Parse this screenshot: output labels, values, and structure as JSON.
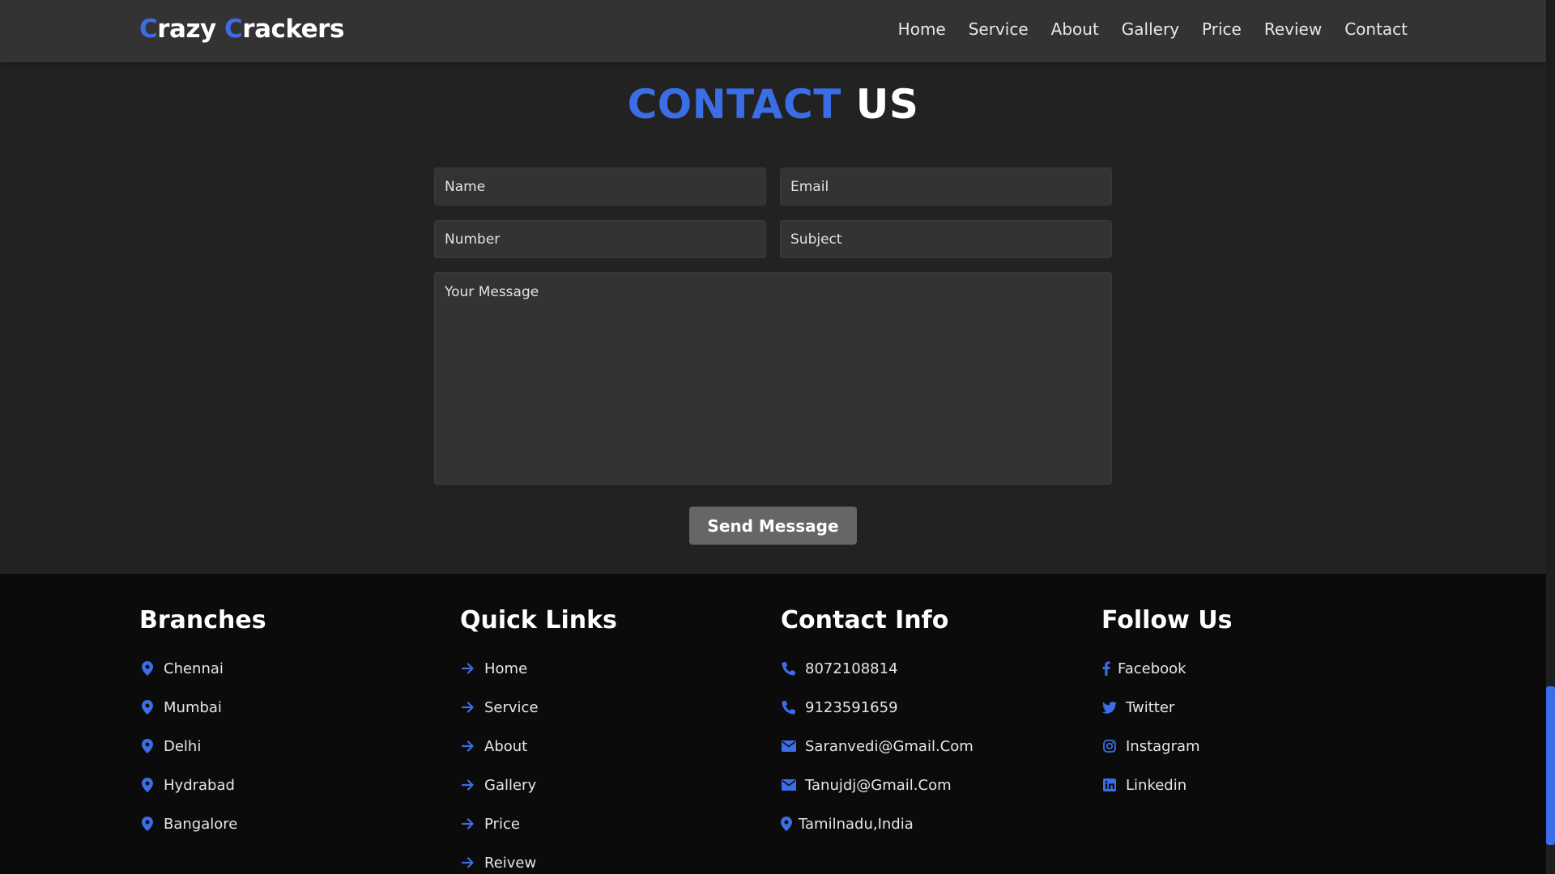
{
  "brand": {
    "first_letter": "C",
    "first_rest": "razy ",
    "second_letter": "C",
    "second_rest": "rackers"
  },
  "nav": {
    "items": [
      "Home",
      "Service",
      "About",
      "Gallery",
      "Price",
      "Review",
      "Contact"
    ]
  },
  "contact": {
    "title_accent": "CONTACT",
    "title_rest": " US",
    "name_placeholder": "Name",
    "email_placeholder": "Email",
    "number_placeholder": "Number",
    "subject_placeholder": "Subject",
    "message_placeholder": "Your Message",
    "send_label": "Send Message"
  },
  "footer": {
    "branches": {
      "title": "Branches",
      "items": [
        "Chennai",
        "Mumbai",
        "Delhi",
        "Hydrabad",
        "Bangalore"
      ],
      "icon": "map-pin-icon"
    },
    "quick_links": {
      "title": "Quick Links",
      "items": [
        "Home",
        "Service",
        "About",
        "Gallery",
        "Price",
        "Reivew"
      ],
      "icon": "arrow-right-icon"
    },
    "contact_info": {
      "title": "Contact Info",
      "items": [
        {
          "text": "8072108814",
          "icon": "phone-icon"
        },
        {
          "text": "9123591659",
          "icon": "phone-icon"
        },
        {
          "text": "Saranvedi@Gmail.Com",
          "icon": "envelope-icon"
        },
        {
          "text": "Tanujdj@Gmail.Com",
          "icon": "envelope-icon"
        },
        {
          "text": "Tamilnadu,India",
          "icon": "map-pin-icon"
        }
      ]
    },
    "follow_us": {
      "title": "Follow Us",
      "items": [
        {
          "text": "Facebook",
          "icon": "facebook-icon"
        },
        {
          "text": "Twitter",
          "icon": "twitter-icon"
        },
        {
          "text": "Instagram",
          "icon": "instagram-icon"
        },
        {
          "text": "Linkedin",
          "icon": "linkedin-icon"
        }
      ]
    }
  },
  "colors": {
    "accent": "#3b6ee6",
    "nav_bg": "#333333",
    "page_bg": "#222222",
    "footer_bg": "#0b0b0b",
    "button_bg": "#666666"
  }
}
